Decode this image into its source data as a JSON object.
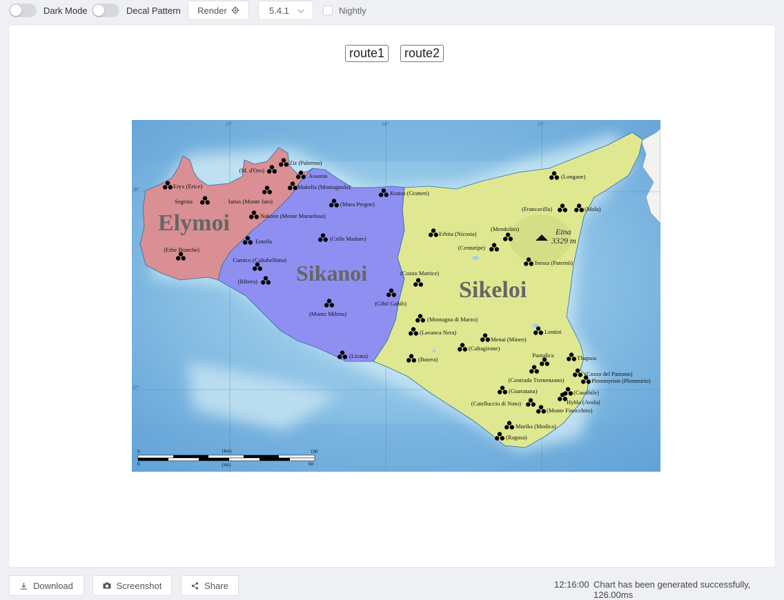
{
  "toolbar": {
    "dark_mode_label": "Dark Mode",
    "decal_label": "Decal Pattern",
    "render_label": "Render",
    "version": "5.4.1",
    "nightly_label": "Nightly"
  },
  "chart": {
    "route1_label": "route1",
    "route2_label": "route2"
  },
  "map": {
    "regions": [
      {
        "name": "Elymoi",
        "color": "#d98f94"
      },
      {
        "name": "Sikanoi",
        "color": "#8f8ff2"
      },
      {
        "name": "Sikeloi",
        "color": "#dfe891"
      }
    ],
    "volcano": {
      "name": "Etna",
      "elevation": "3329 m"
    },
    "graticule": {
      "lon": [
        "13°",
        "14°",
        "15°"
      ],
      "lat": [
        "38°",
        "37°"
      ]
    },
    "scale": {
      "km_start": "0",
      "km_unit": "(km)",
      "km_end": "100",
      "mi_start": "0",
      "mi_unit": "(mi)",
      "mi_end": "60"
    },
    "sites": [
      "Ziz (Palermo)",
      "(M. d'Oro)",
      "Assorus",
      "Eryx (Erice)",
      "Makella (Montagnola)",
      "Segesta",
      "Iaitas (Monte Jato)",
      "Nakone (Monte Maranfusa)",
      "(Mura Pregne)",
      "Kratos (Gratteri)",
      "(Longane)",
      "(Francavilla)",
      "(Mola)",
      "Entella",
      "(Colle Madore)",
      "Erbita (Nicosia)",
      "(Mendolito)",
      "(Centuripe)",
      "(Erbe Bianche)",
      "Camico (Caltabellotta)",
      "(Ribera)",
      "Inessa (Paternò)",
      "(Cozzo Matrice)",
      "(Gibil Gabib)",
      "(Monte Milena)",
      "(Montagna di Marzo)",
      "(Lavanca Nera)",
      "Menai (Mineo)",
      "Lentini",
      "(Caltagirone)",
      "(Licata)",
      "(Butera)",
      "Pantalica",
      "Thapsos",
      "(Cozzo del Pantano)",
      "(Contrada Tremenzano)",
      "Plemmyrion (Plemmirio)",
      "(Giarratana)",
      "(Cassibile)",
      "Hybla (Avola)",
      "(Catelluccio di Noto)",
      "(Monte Finocchito)",
      "Murika (Modica)",
      "(Ragusa)"
    ]
  },
  "bottom": {
    "download_label": "Download",
    "screenshot_label": "Screenshot",
    "share_label": "Share",
    "time": "12:16:00",
    "message": "Chart has been generated successfully, 126.00ms"
  }
}
